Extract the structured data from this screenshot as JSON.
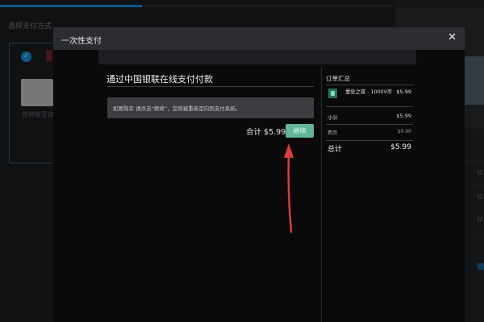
{
  "background": {
    "section_label": "选择支付方式",
    "card_text": "您将被至自",
    "right_letters": [
      "U",
      "U",
      "U"
    ]
  },
  "modal": {
    "title": "一次性支付",
    "close_icon": "close-icon",
    "payment_title": "通过中国银联在线支付付款",
    "notice": "如要购买 请点击“继续”，您将被重新定向到支付系统。",
    "total_label": "合计 $5.99",
    "continue_label": "继续"
  },
  "summary": {
    "title": "订单汇总",
    "item": {
      "name": "堡垒之夜 - 1000V币",
      "price": "$5.99",
      "icon": "vbucks-icon"
    },
    "subtotal_label": "小计",
    "subtotal_value": "$5.99",
    "tax_label": "费用",
    "tax_value": "$0.00",
    "total_label": "总计",
    "total_value": "$5.99"
  },
  "colors": {
    "accent": "#1a9fff",
    "continue_button": "#5fb69a",
    "annotation_arrow": "#e03a3a"
  }
}
